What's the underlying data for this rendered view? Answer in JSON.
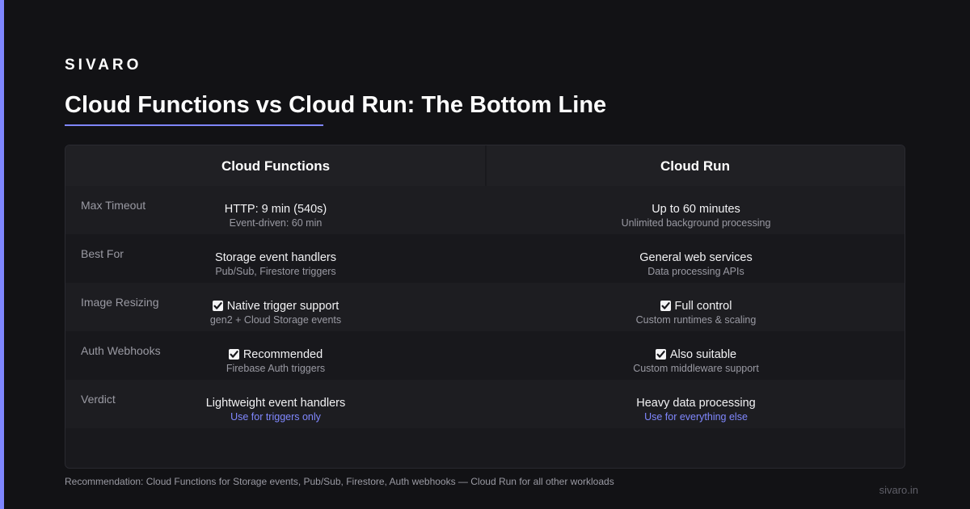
{
  "brand": "SIVARO",
  "title": "Cloud Functions vs Cloud Run: The Bottom Line",
  "colors": {
    "accent": "#7f86ff",
    "background": "#121215",
    "link": "#8088ff"
  },
  "table": {
    "headers": [
      "Cloud Functions",
      "Cloud Run"
    ],
    "rows": [
      {
        "label": "Max Timeout",
        "left": {
          "main": "HTTP: 9 min (540s)",
          "sub": "Event-driven: 60 min",
          "check": false
        },
        "right": {
          "main": "Up to 60 minutes",
          "sub": "Unlimited background processing",
          "check": false
        }
      },
      {
        "label": "Best For",
        "left": {
          "main": "Storage event handlers",
          "sub": "Pub/Sub, Firestore triggers",
          "check": false
        },
        "right": {
          "main": "General web services",
          "sub": "Data processing APIs",
          "check": false
        }
      },
      {
        "label": "Image Resizing",
        "left": {
          "main": "Native trigger support",
          "sub": "gen2 + Cloud Storage events",
          "check": true
        },
        "right": {
          "main": "Full control",
          "sub": "Custom runtimes & scaling",
          "check": true
        }
      },
      {
        "label": "Auth Webhooks",
        "left": {
          "main": "Recommended",
          "sub": "Firebase Auth triggers",
          "check": true
        },
        "right": {
          "main": "Also suitable",
          "sub": "Custom middleware support",
          "check": true
        }
      },
      {
        "label": "Verdict",
        "left": {
          "main": "Lightweight event handlers",
          "sub": "Use for triggers only",
          "check": false
        },
        "right": {
          "main": "Heavy data processing",
          "sub": "Use for everything else",
          "check": false
        }
      }
    ]
  },
  "footnote": "Recommendation: Cloud Functions for Storage events, Pub/Sub, Firestore, Auth webhooks — Cloud Run for all other workloads",
  "site": "sivaro.in",
  "icons": {
    "check": "checkbox-checked-icon"
  }
}
